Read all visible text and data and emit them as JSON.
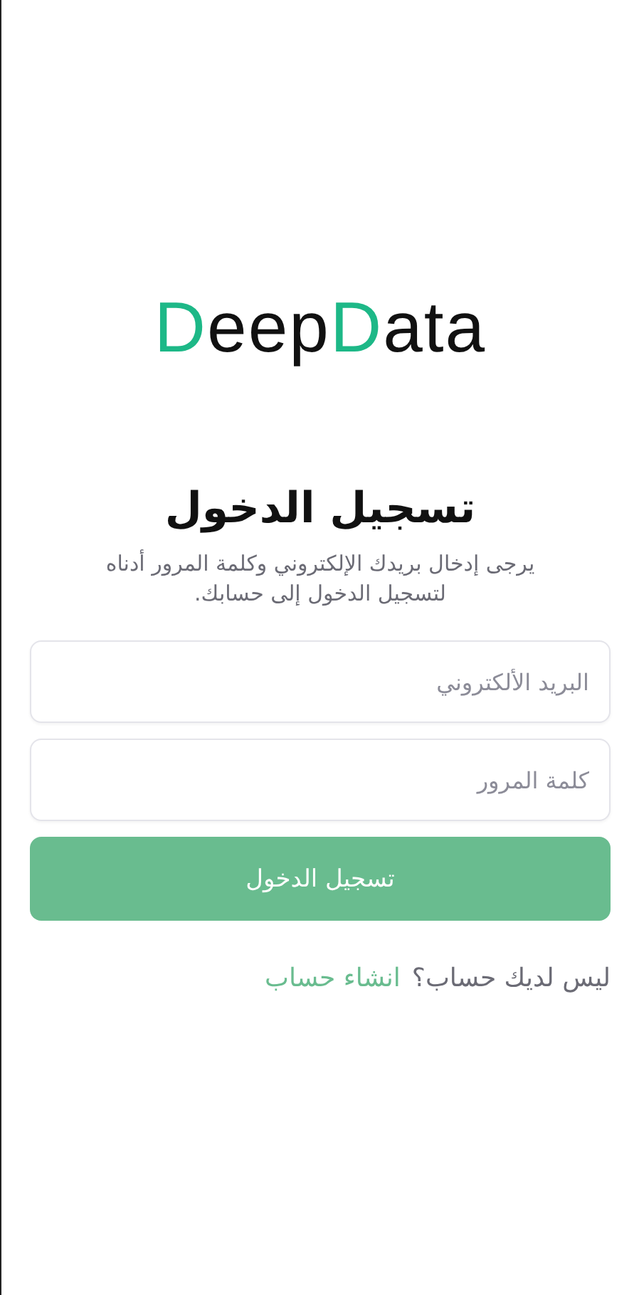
{
  "logo": "**D**eep**D**ata",
  "title": "تسجيل الدخول",
  "subtitle": "يرجى إدخال بريدك الإلكتروني وكلمة المرور أدناه لتسجيل الدخول إلى حسابك.",
  "fields": [
    {
      "placeholder": "البريد الألكتروني"
    },
    {
      "placeholder": "كلمة المرور"
    }
  ],
  "submit": {
    "label": "تسجيل الدخول"
  },
  "signup": {
    "prompt": "ليس لديك حساب؟",
    "link": "انشاء حساب"
  }
}
